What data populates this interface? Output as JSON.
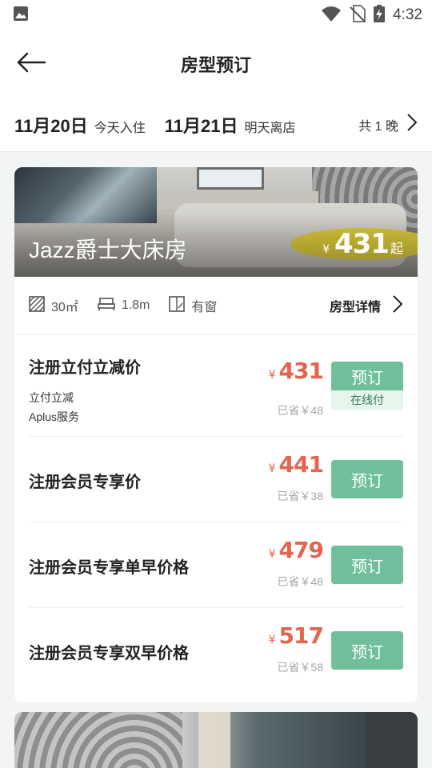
{
  "status_bar": {
    "time": "4:32",
    "icons": [
      "image-icon",
      "wifi-icon",
      "no-sim-icon",
      "battery-charging-icon"
    ]
  },
  "header": {
    "title": "房型预订",
    "back_icon": "back-arrow-icon"
  },
  "dates": {
    "checkin_date": "11月20日",
    "checkin_label": "今天入住",
    "checkout_date": "11月21日",
    "checkout_label": "明天离店",
    "nights": "共 1 晚"
  },
  "room": {
    "name": "Jazz爵士大床房",
    "currency": "¥",
    "price": "431",
    "price_suffix": "起",
    "area": "30㎡",
    "bed": "1.8m",
    "window": "有窗",
    "detail_label": "房型详情"
  },
  "rates": [
    {
      "name": "注册立付立减价",
      "sub1": "立付立减",
      "sub2": "Aplus服务",
      "currency": "¥",
      "price": "431",
      "saved": "已省￥48",
      "button": "预订",
      "button_sub": "在线付"
    },
    {
      "name": "注册会员专享价",
      "currency": "¥",
      "price": "441",
      "saved": "已省￥38",
      "button": "预订"
    },
    {
      "name": "注册会员专享单早价格",
      "currency": "¥",
      "price": "479",
      "saved": "已省￥48",
      "button": "预订"
    },
    {
      "name": "注册会员专享双早价格",
      "currency": "¥",
      "price": "517",
      "saved": "已省￥58",
      "button": "预订"
    }
  ],
  "colors": {
    "accent_green": "#6fc09a",
    "price_red": "#e2654e",
    "muted": "#a6a6a6"
  }
}
